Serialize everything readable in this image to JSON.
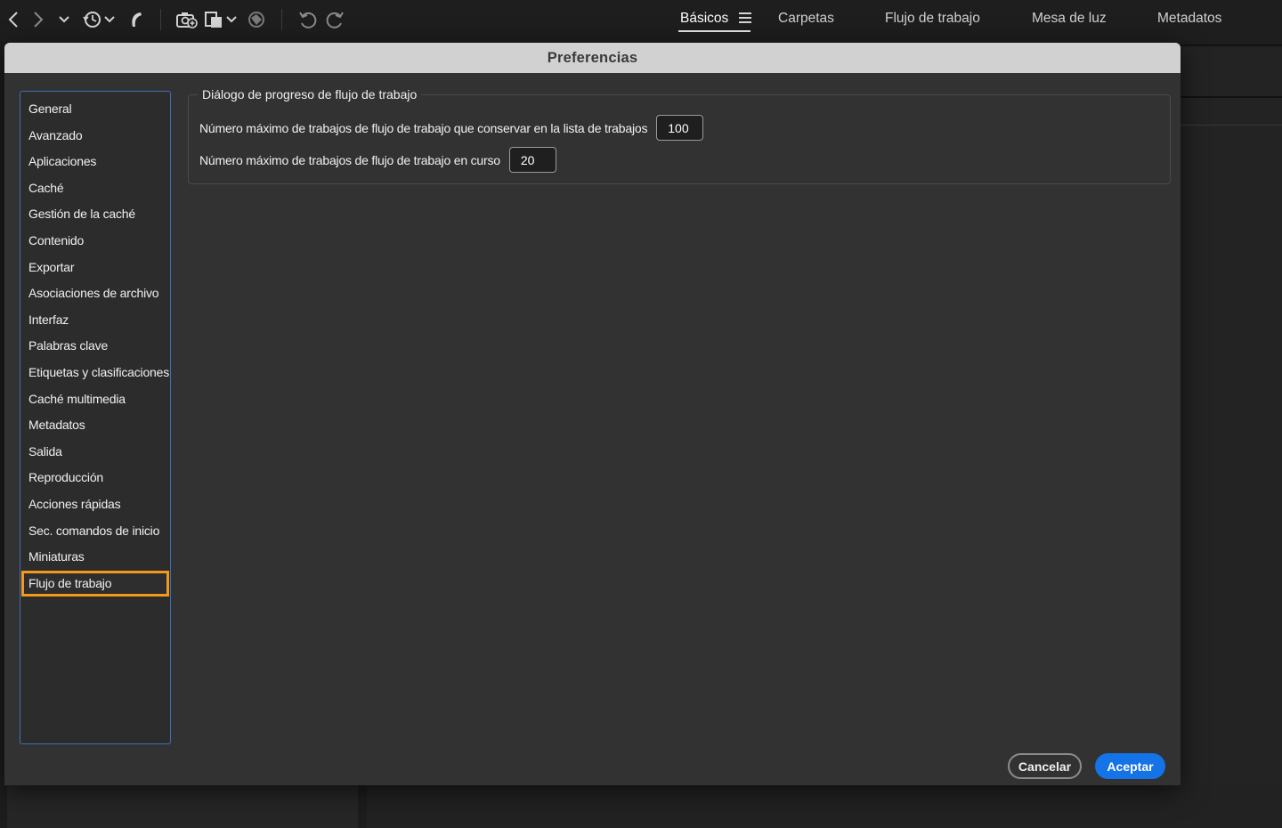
{
  "workspace_tabs": [
    {
      "label": "Básicos",
      "active": true
    },
    {
      "label": "Carpetas",
      "active": false
    },
    {
      "label": "Flujo de trabajo",
      "active": false
    },
    {
      "label": "Mesa de luz",
      "active": false
    },
    {
      "label": "Metadatos",
      "active": false
    }
  ],
  "toolbar_icons": [
    "back-arrow-icon",
    "forward-arrow-icon",
    "chevron-down-icon",
    "recent-history-icon",
    "boomerang-icon",
    "camera-get-photos-icon",
    "copy-to-folder-icon",
    "refine-icon",
    "rotate-left-icon",
    "rotate-right-icon"
  ],
  "dialog": {
    "title": "Preferencias",
    "categories": [
      "General",
      "Avanzado",
      "Aplicaciones",
      "Caché",
      "Gestión de la caché",
      "Contenido",
      "Exportar",
      "Asociaciones de archivo",
      "Interfaz",
      "Palabras clave",
      "Etiquetas y clasificaciones",
      "Caché multimedia",
      "Metadatos",
      "Salida",
      "Reproducción",
      "Acciones rápidas",
      "Sec. comandos de inicio",
      "Miniaturas",
      "Flujo de trabajo"
    ],
    "selected_category": "Flujo de trabajo",
    "group": {
      "legend": "Diálogo de progreso de flujo de trabajo",
      "fields": [
        {
          "label": "Número máximo de trabajos de flujo de trabajo que conservar en la lista de trabajos",
          "value": "100"
        },
        {
          "label": "Número máximo de trabajos de flujo de trabajo en curso",
          "value": "20"
        }
      ]
    },
    "cancel_label": "Cancelar",
    "ok_label": "Aceptar"
  },
  "colors": {
    "selection_outline": "#f39a1e",
    "list_border": "#3f6fb5",
    "primary_button": "#1473e6"
  }
}
